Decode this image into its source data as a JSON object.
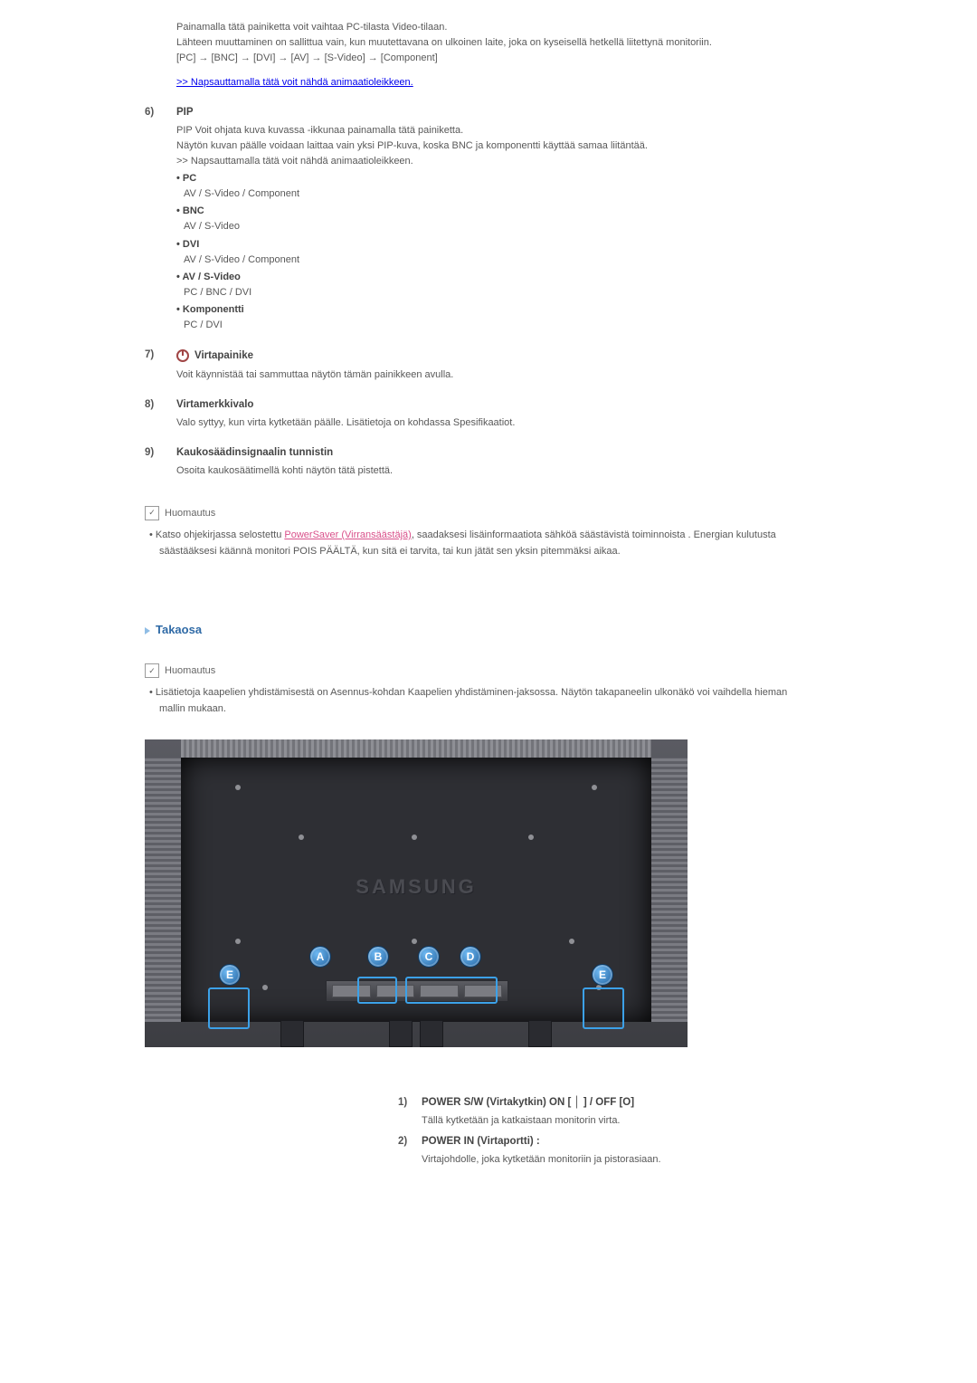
{
  "intro_p1": "Painamalla tätä painiketta voit vaihtaa PC-tilasta Video-tilaan.",
  "intro_p2": "Lähteen muuttaminen on sallittua vain, kun muutettavana on ulkoinen laite, joka on kyseisellä hetkellä liitettynä monitoriin.",
  "intro_seq": "[PC] → [BNC] → [DVI] → [AV] → [S-Video] → [Component]",
  "animation_link": ">> Napsauttamalla tätä voit nähdä animaatioleikkeen.",
  "s6": {
    "num": "6)",
    "title": "PIP",
    "p1": "PIP Voit ohjata kuva kuvassa -ikkunaa painamalla tätä painiketta.",
    "p2": "Näytön kuvan päälle voidaan laittaa vain yksi PIP-kuva, koska BNC ja komponentti käyttää samaa liitäntää.",
    "p3": ">> Napsauttamalla tätä voit nähdä animaatioleikkeen.",
    "modes": [
      {
        "name": "PC",
        "opts": "AV / S-Video / Component"
      },
      {
        "name": "BNC",
        "opts": "AV / S-Video"
      },
      {
        "name": "DVI",
        "opts": "AV / S-Video / Component"
      },
      {
        "name": "AV / S-Video",
        "opts": "PC / BNC / DVI"
      },
      {
        "name": "Komponentti",
        "opts": "PC / DVI"
      }
    ]
  },
  "s7": {
    "num": "7)",
    "title": "Virtapainike",
    "body": "Voit käynnistää tai sammuttaa näytön tämän painikkeen avulla."
  },
  "s8": {
    "num": "8)",
    "title": "Virtamerkkivalo",
    "body": "Valo syttyy, kun virta kytketään päälle. Lisätietoja on kohdassa Spesifikaatiot."
  },
  "s9": {
    "num": "9)",
    "title": "Kaukosäädinsignaalin tunnistin",
    "body": "Osoita kaukosäätimellä kohti näytön tätä pistettä."
  },
  "note_label": "Huomautus",
  "note1_before": "Katso ohjekirjassa selostettu ",
  "note1_link": "PowerSaver (Virransäästäjä)",
  "note1_after": ", saadaksesi lisäinformaatiota sähköä säästävistä toiminnoista . Energian kulutusta säästääksesi käännä monitori POIS PÄÄLTÄ, kun sitä ei tarvita, tai kun jätät sen yksin pitemmäksi aikaa.",
  "takaosa_heading": "Takaosa",
  "note2": "Lisätietoja kaapelien yhdistämisestä on Asennus-kohdan Kaapelien yhdistäminen-jaksossa. Näytön takapaneelin ulkonäkö voi vaihdella hieman mallin mukaan.",
  "diagram": {
    "brand": "SAMSUNG",
    "badges": [
      "A",
      "B",
      "C",
      "D",
      "E",
      "E"
    ]
  },
  "back": {
    "i1_num": "1)",
    "i1_title": "POWER S/W (Virtakytkin) ON [ │ ] / OFF [O]",
    "i1_body": "Tällä kytketään ja katkaistaan monitorin virta.",
    "i2_num": "2)",
    "i2_title": "POWER IN (Virtaportti) :",
    "i2_body": "Virtajohdolle, joka kytketään monitoriin ja pistorasiaan."
  }
}
